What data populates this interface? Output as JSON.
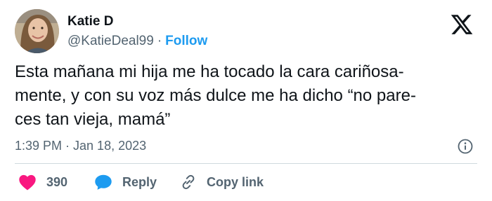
{
  "author": {
    "display_name": "Katie D",
    "handle": "@KatieDeal99",
    "separator": "·",
    "follow_label": "Follow"
  },
  "tweet": {
    "lines": [
      "Esta mañana mi hija me ha tocado la cara cariñosa-",
      "mente, y con su voz más dulce me ha dicho “no pare-",
      "ces tan vieja, mamá”"
    ],
    "timestamp": "1:39 PM · Jan 18, 2023"
  },
  "actions": {
    "like_count": "390",
    "reply_label": "Reply",
    "copy_link_label": "Copy link"
  },
  "icons": {
    "brand": "x-logo-icon",
    "info": "info-icon",
    "like": "heart-icon",
    "reply": "speech-bubble-icon",
    "copy": "link-icon"
  },
  "colors": {
    "like": "#f91880",
    "reply": "#1d9bf0",
    "follow": "#1d9bf0",
    "secondary_text": "#536471"
  }
}
